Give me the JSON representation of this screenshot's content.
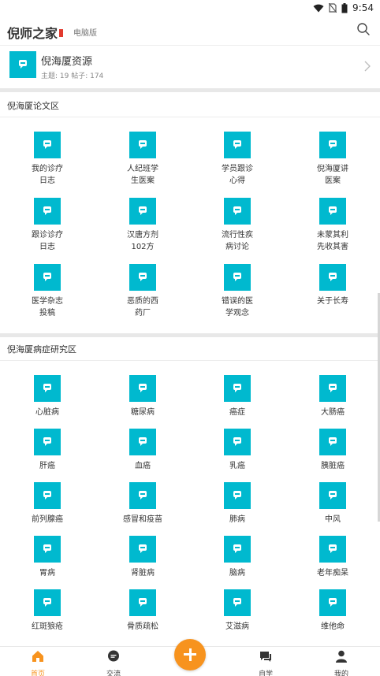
{
  "status_bar": {
    "time": "9:54"
  },
  "header": {
    "title": "倪师之家",
    "desktop_link": "电脑版"
  },
  "resource": {
    "title": "倪海厦资源",
    "meta": "主题: 19  帖子: 174"
  },
  "sections": [
    {
      "title": "倪海厦论文区",
      "items": [
        "我的诊疗\n日志",
        "人纪班学\n生医案",
        "学员跟诊\n心得",
        "倪海厦讲\n医案",
        "跟诊诊疗\n日志",
        "汉唐方剂\n102方",
        "流行性疾\n病讨论",
        "未蒙其利\n先收其害",
        "医学杂志\n投稿",
        "恶质的西\n药厂",
        "错误的医\n学观念",
        "关于长寿"
      ]
    },
    {
      "title": "倪海厦病症研究区",
      "items": [
        "心脏病",
        "糖尿病",
        "癌症",
        "大肠癌",
        "肝癌",
        "血癌",
        "乳癌",
        "胰脏癌",
        "前列腺癌",
        "感冒和疫苗",
        "肺病",
        "中风",
        "胃病",
        "肾脏病",
        "脑病",
        "老年痴呆",
        "红斑狼疮",
        "骨质疏松",
        "艾滋病",
        "维他命"
      ]
    }
  ],
  "tabs": [
    "首页",
    "交流",
    "自学",
    "我的"
  ],
  "colors": {
    "accent": "#f7931e",
    "tile": "#00b9cf"
  }
}
